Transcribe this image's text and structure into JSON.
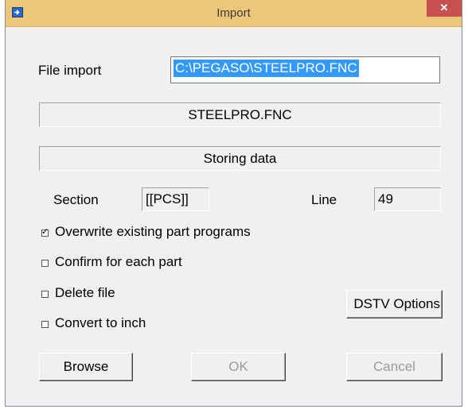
{
  "window": {
    "title": "Import",
    "close_glyph": "✕",
    "app_icon": "import-app-icon"
  },
  "file_import": {
    "label": "File import",
    "value": "C:\\PEGASO\\STEELPRO.FNC"
  },
  "file_name_panel": "STEELPRO.FNC",
  "status_panel": "Storing data",
  "section": {
    "label": "Section",
    "value": "[[PCS]]"
  },
  "line": {
    "label": "Line",
    "value": "49"
  },
  "options": [
    {
      "label": "Overwrite existing part programs",
      "checked": true
    },
    {
      "label": "Confirm for each part",
      "checked": false
    },
    {
      "label": "Delete file",
      "checked": false
    },
    {
      "label": "Convert to inch",
      "checked": false
    }
  ],
  "buttons": {
    "dstv": "DSTV Options",
    "browse": "Browse",
    "ok": "OK",
    "cancel": "Cancel"
  },
  "colors": {
    "titlebar": "#eec67a",
    "close": "#c75050",
    "selection": "#3399ff"
  }
}
